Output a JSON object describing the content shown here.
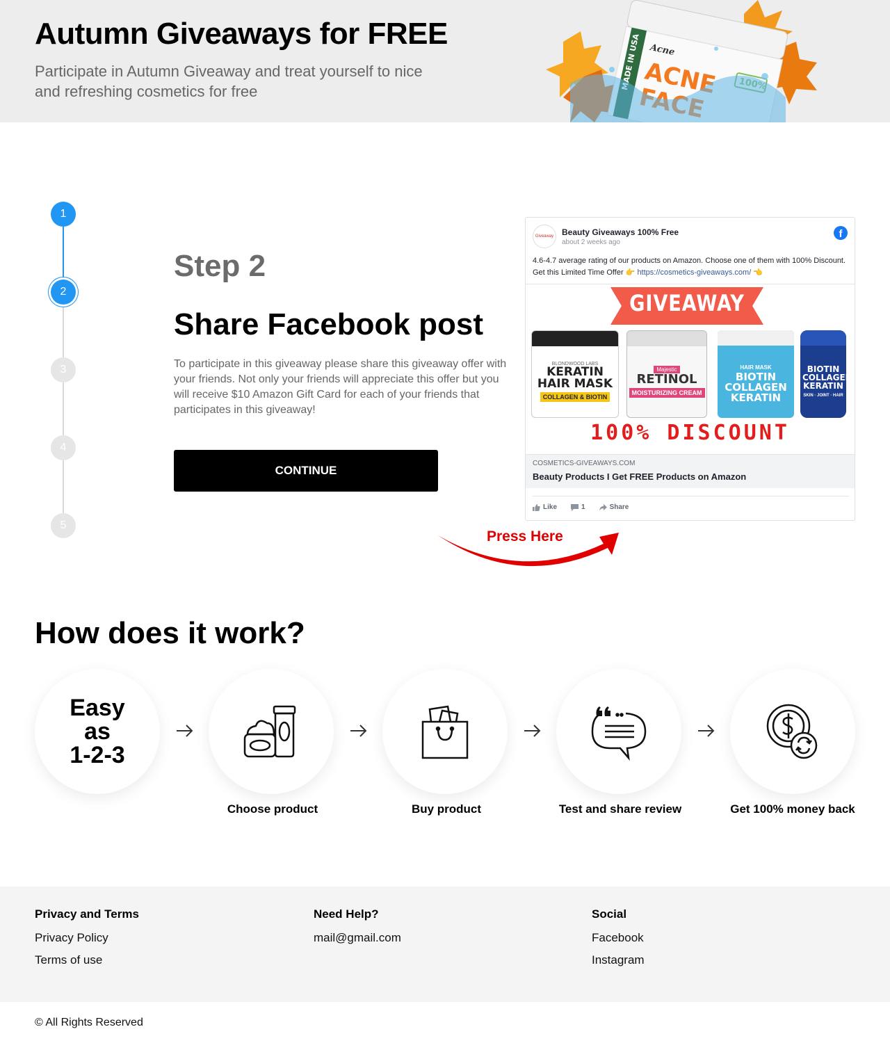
{
  "header": {
    "title": "Autumn Giveaways for FREE",
    "subtitle": "Participate in Autumn Giveaway and treat yourself to nice and refreshing cosmetics for free",
    "product_art_text": "Acne TREATMENT Inc ACNE FACE MADE IN USA 100%"
  },
  "stepper": {
    "steps": [
      "1",
      "2",
      "3",
      "4",
      "5"
    ],
    "current": 2,
    "active_color": "#2196f3",
    "inactive_color": "#e6e6e6"
  },
  "step": {
    "label": "Step 2",
    "title": "Share Facebook post",
    "description": "To participate in this giveaway please share this giveaway offer with your friends. Not only your friends will appreciate this offer but you will receive $10 Amazon Gift Card for each of your friends that participates in this giveaway!",
    "continue_label": "CONTINUE"
  },
  "facebook_post": {
    "page_name": "Beauty Giveaways 100% Free",
    "avatar_text": "Giveaway",
    "time": "about 2 weeks ago",
    "text_prefix": "4.6-4.7 average rating of our products on Amazon. Choose one of them with 100% Discount. Get this Limited Time Offer 👉 ",
    "link": "https://cosmetics-giveaways.com/",
    "text_suffix": " 👈",
    "image": {
      "banner": "GIVEAWAY",
      "products": [
        {
          "brand": "BLONDWOOD LABS",
          "name": "KERATIN HAIR MASK",
          "tag": "COLLAGEN & BIOTIN"
        },
        {
          "brand": "Majestic",
          "name": "RETINOL",
          "tag": "MOISTURIZING CREAM"
        },
        {
          "brand": "",
          "name": "BIOTIN COLLAGEN KERATIN",
          "tag": "HAIR MASK"
        },
        {
          "brand": "",
          "name": "BIOTIN COLLAGEN KERATIN",
          "tag": "SKIN · JOINT · HAIR"
        }
      ],
      "discount": "100% DISCOUNT"
    },
    "link_domain": "COSMETICS-GIVEAWAYS.COM",
    "link_title": "Beauty Products I Get FREE Products on Amazon",
    "actions": {
      "like": "Like",
      "comments": "1",
      "share": "Share"
    }
  },
  "press_here": "Press Here",
  "how": {
    "title": "How does it work?",
    "easy": [
      "Easy",
      "as",
      "1-2-3"
    ],
    "steps": [
      {
        "label": "Choose product",
        "icon": "cosmetics-icon"
      },
      {
        "label": "Buy product",
        "icon": "shopping-bag-icon"
      },
      {
        "label": "Test and share review",
        "icon": "review-chat-icon"
      },
      {
        "label": "Get 100% money back",
        "icon": "money-back-icon"
      }
    ]
  },
  "footer": {
    "privacy": {
      "heading": "Privacy and Terms",
      "links": [
        "Privacy Policy",
        "Terms of use"
      ]
    },
    "help": {
      "heading": "Need Help?",
      "email": "mail@gmail.com"
    },
    "social": {
      "heading": "Social",
      "links": [
        "Facebook",
        "Instagram"
      ]
    },
    "copyright": "© All Rights Reserved"
  }
}
